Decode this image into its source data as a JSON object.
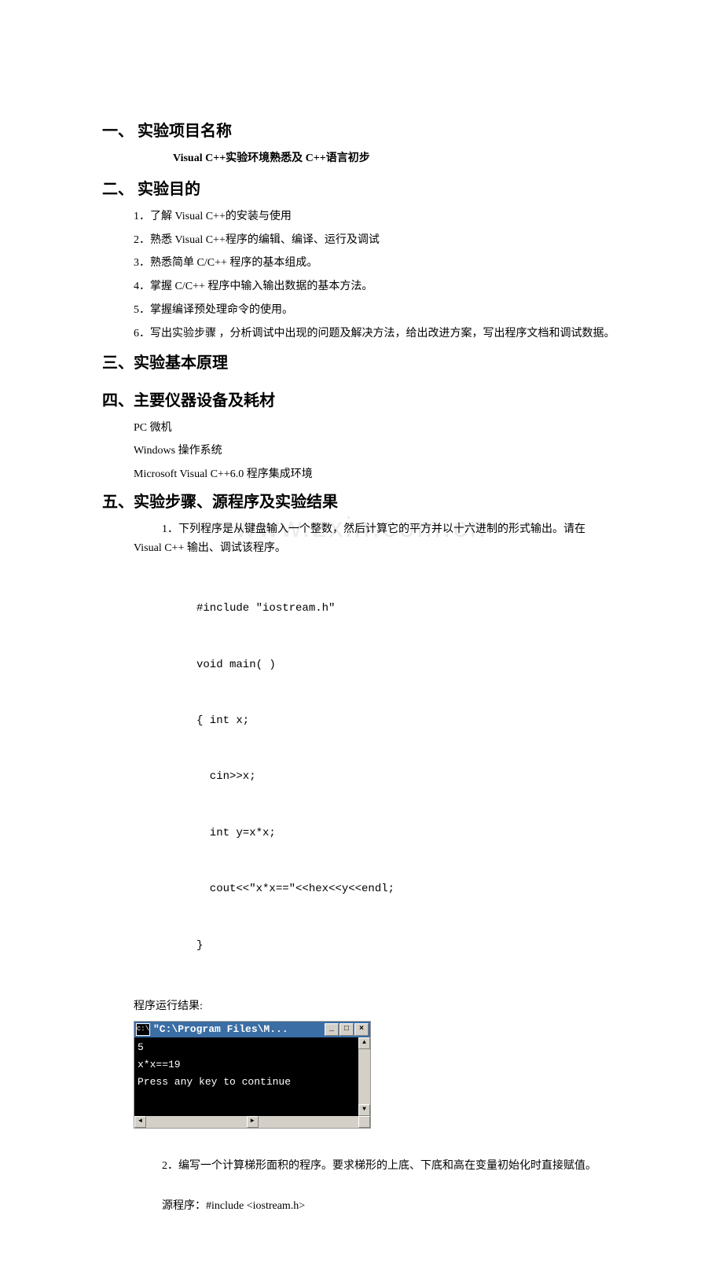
{
  "section1": {
    "heading": "一、 实验项目名称",
    "subtitle": "Visual   C++实验环境熟悉及 C++语言初步"
  },
  "section2": {
    "heading": "二、 实验目的",
    "items": [
      "1．了解 Visual C++的安装与使用",
      "2．熟悉 Visual C++程序的编辑、编译、运行及调试",
      "3．熟悉简单 C/C++ 程序的基本组成。",
      "4．掌握 C/C++ 程序中输入输出数据的基本方法。",
      "5．掌握编译预处理命令的使用。"
    ],
    "item6": "6．写出实验步骤 ，分析调试中出现的问题及解决方法，给出改进方案，写出程序文档和调试数据。"
  },
  "section3": {
    "heading": "三、实验基本原理"
  },
  "section4": {
    "heading": "四、主要仪器设备及耗材",
    "items": [
      "PC 微机",
      "Windows 操作系统",
      "Microsoft Visual C++6.0 程序集成环境"
    ]
  },
  "section5": {
    "heading": "五、实验步骤、源程序及实验结果",
    "task1_desc_a": "1．下列程序是从键盘输入一个整数，然后计算它的平方并以十六进制的形式输出。请在",
    "task1_desc_b": "Visual C++ 输出、调试该程序。",
    "code1": [
      "#include \"iostream.h\"",
      "void main( )",
      "{ int x;",
      "  cin>>x;",
      "  int y=x*x;",
      "  cout<<\"x*x==\"<<hex<<y<<endl;",
      "}"
    ],
    "result_label": "程序运行结果:",
    "console": {
      "title": "\"C:\\Program Files\\M...",
      "lines": [
        "5",
        "x*x==19",
        "Press any key to continue"
      ]
    },
    "task2_desc": "2．编写一个计算梯形面积的程序。要求梯形的上底、下底和高在变量初始化时直接赋值。",
    "src_label": "源程序：",
    "src_code": "#include <iostream.h>"
  },
  "watermark": "www.zxin.com.cn"
}
